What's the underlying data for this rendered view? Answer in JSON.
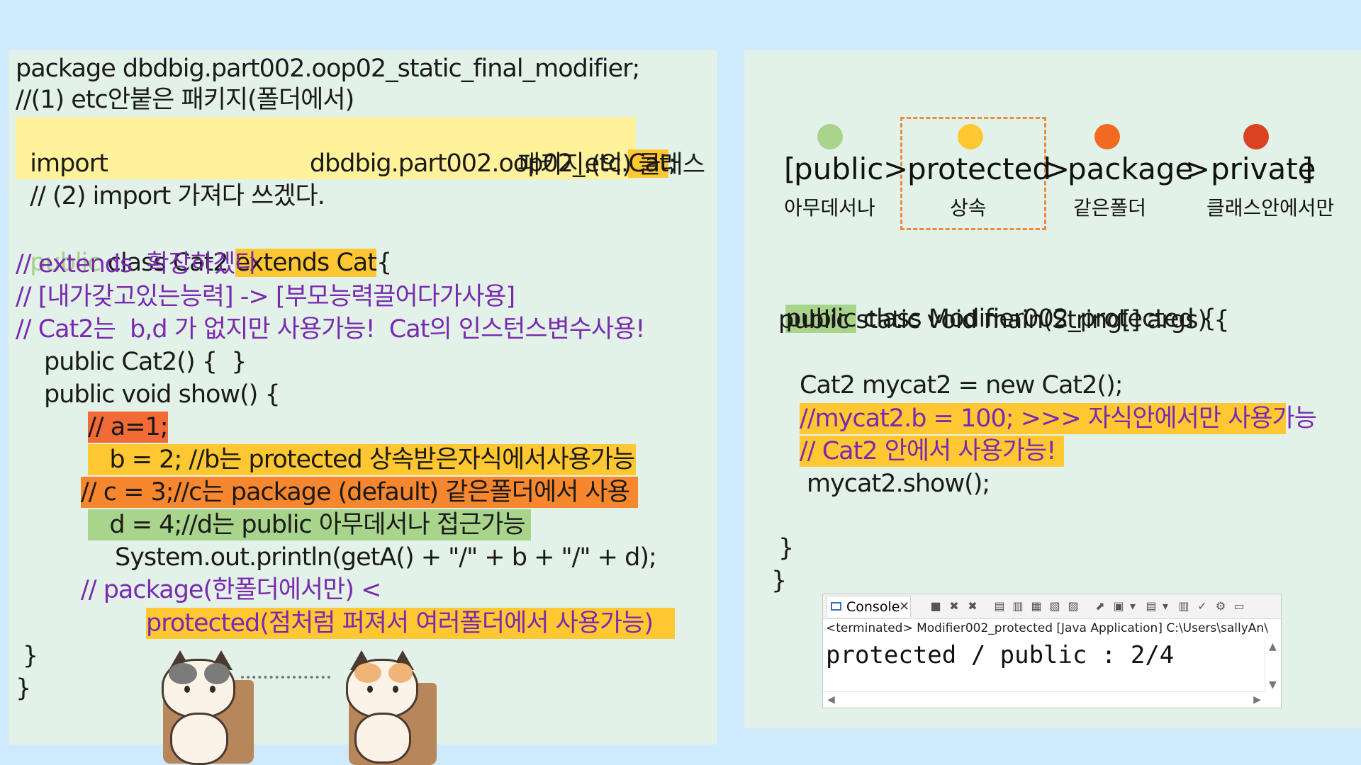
{
  "left_code": {
    "line1": "package dbdbig.part002.oop02_static_final_modifier;",
    "line2": "//(1) etc안붙은 패키지(폴더에서)",
    "line3_a": "import",
    "line3_b": "dbdbig.part002.oop02_etc.",
    "line3_c": "Cat",
    "line3_d": ";",
    "line4_a": "// (2) import 가져다 쓰겠다.",
    "line4_b": "패키지.(의) 클래스",
    "line5_a": "public",
    "line5_b": " class Cat2 ",
    "line5_c": "extends Cat",
    "line5_d": "{",
    "line6": "// extends  확장하겠다",
    "line7": "// [내가갖고있는능력] -> [부모능력끌어다가사용]",
    "line8": "// Cat2는  b,d 가 없지만 사용가능!  Cat의 인스턴스변수사용!",
    "line9": "public Cat2() {  }",
    "line10": "public void show() {",
    "line11": "// a=1;",
    "line12": "   b = 2; //b는 protected 상속받은자식에서사용가능",
    "line13": "// c = 3;//c는 package (default) 같은폴더에서 사용",
    "line14": "   d = 4;//d는 public 아무데서나 접근가능",
    "line15": "System.out.println(getA() + \"/\" + b + \"/\" + d);",
    "line16": "// package(한폴더에서만) <",
    "line17": "protected(점처럼 퍼져서 여러폴더에서 사용가능)",
    "line18": "}",
    "line19": "}"
  },
  "access_levels": {
    "open_bracket": "[",
    "items": [
      {
        "keyword": "public",
        "desc": "아무데서나",
        "color": "#a9d48c"
      },
      {
        "keyword": "protected",
        "desc": "상속",
        "color": "#ffc832"
      },
      {
        "keyword": "package",
        "desc": "같은폴더",
        "color": "#f26a22"
      },
      {
        "keyword": "private",
        "desc": "클래스안에서만",
        "color": "#d94322"
      }
    ],
    "separator": ">",
    "close_bracket": "]"
  },
  "right_code": {
    "line1_a": "public",
    "line1_b": " class Modifier002_protected {",
    "line2": "public static void main(String[] args) {",
    "line3": "Cat2 mycat2 = new Cat2();",
    "line4": "//mycat2.b = 100; >>> 자식안에서만 사용가능",
    "line5": "// Cat2 안에서 사용가능!",
    "line6": "mycat2.show();",
    "line7": "}",
    "line8": "}"
  },
  "console": {
    "tab_label": "Console",
    "close_symbol": "✕",
    "status": "<terminated> Modifier002_protected [Java Application] C:\\Users\\sallyAn\\",
    "output": "protected / public : 2/4"
  },
  "colors": {
    "background": "#cfeafb",
    "panel": "#e3f2e8",
    "comment_purple": "#7a2ab0",
    "highlight_yellow": "#fff29a",
    "highlight_orange": "#ffc832",
    "highlight_red": "#f26a35",
    "highlight_green": "#a9d48c"
  }
}
